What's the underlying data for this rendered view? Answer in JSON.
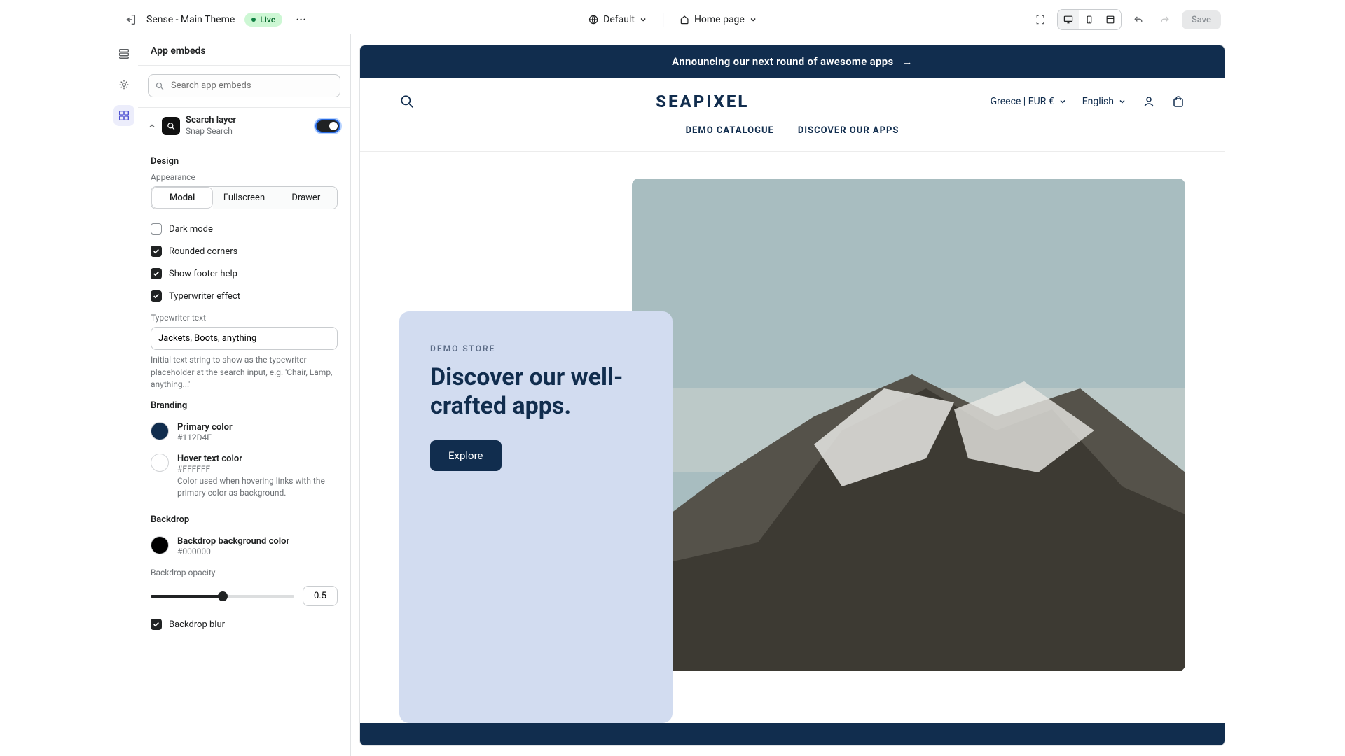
{
  "topbar": {
    "theme_name": "Sense - Main Theme",
    "live_label": "Live",
    "more_label": "···",
    "view_mode": "Default",
    "page": "Home page",
    "save_label": "Save"
  },
  "sidebar": {
    "title": "App embeds",
    "search_placeholder": "Search app embeds",
    "embed": {
      "title": "Search layer",
      "subtitle": "Snap Search",
      "enabled": true
    },
    "design": {
      "heading": "Design",
      "appearance_label": "Appearance",
      "appearance_options": [
        "Modal",
        "Fullscreen",
        "Drawer"
      ],
      "appearance_selected": "Modal",
      "dark_mode": {
        "label": "Dark mode",
        "checked": false
      },
      "rounded_corners": {
        "label": "Rounded corners",
        "checked": true
      },
      "show_footer_help": {
        "label": "Show footer help",
        "checked": true
      },
      "typewriter_effect": {
        "label": "Typerwriter effect",
        "checked": true
      },
      "typewriter_text_label": "Typewriter text",
      "typewriter_text_value": "Jackets, Boots, anything",
      "typewriter_help": "Initial text string to show as the typewriter placeholder at the search input, e.g. 'Chair, Lamp, anything...'"
    },
    "branding": {
      "heading": "Branding",
      "primary": {
        "label": "Primary color",
        "hex": "#112D4E"
      },
      "hover": {
        "label": "Hover text color",
        "hex": "#FFFFFF",
        "help": "Color used when hovering links with the primary color as background."
      }
    },
    "backdrop": {
      "heading": "Backdrop",
      "bg": {
        "label": "Backdrop background color",
        "hex": "#000000"
      },
      "opacity_label": "Backdrop opacity",
      "opacity_value": "0.5",
      "blur": {
        "label": "Backdrop blur",
        "checked": true
      }
    }
  },
  "preview": {
    "announcement": "Announcing our next round of awesome apps",
    "logo": "SEAPIXEL",
    "locale": "Greece | EUR €",
    "language": "English",
    "nav": [
      "DEMO CATALOGUE",
      "DISCOVER OUR APPS"
    ],
    "hero": {
      "eyebrow": "DEMO STORE",
      "title": "Discover our well-crafted apps.",
      "cta": "Explore"
    }
  }
}
